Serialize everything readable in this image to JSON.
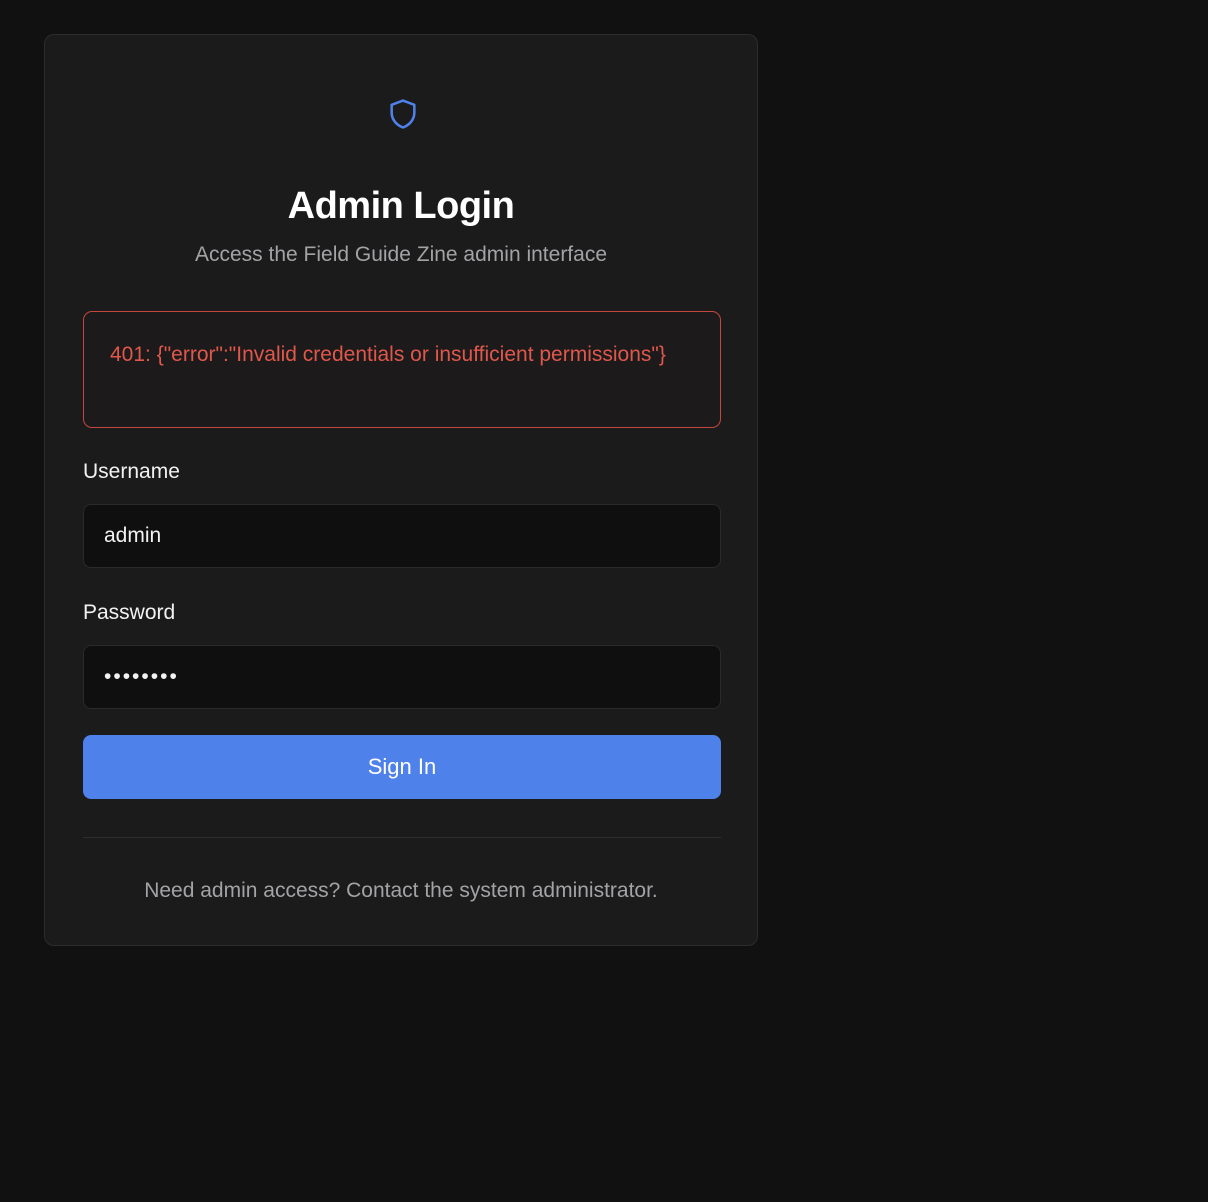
{
  "login": {
    "icon": "shield-icon",
    "title": "Admin Login",
    "subtitle": "Access the Field Guide Zine admin interface",
    "error_message": "401: {\"error\":\"Invalid credentials or insufficient permissions\"}",
    "username_label": "Username",
    "username_value": "admin",
    "password_label": "Password",
    "password_value": "password",
    "submit_label": "Sign In",
    "footer_note": "Need admin access? Contact the system administrator."
  },
  "colors": {
    "background": "#111111",
    "card": "#1b1b1c",
    "accent": "#4f81ea",
    "error": "#e0574c"
  }
}
